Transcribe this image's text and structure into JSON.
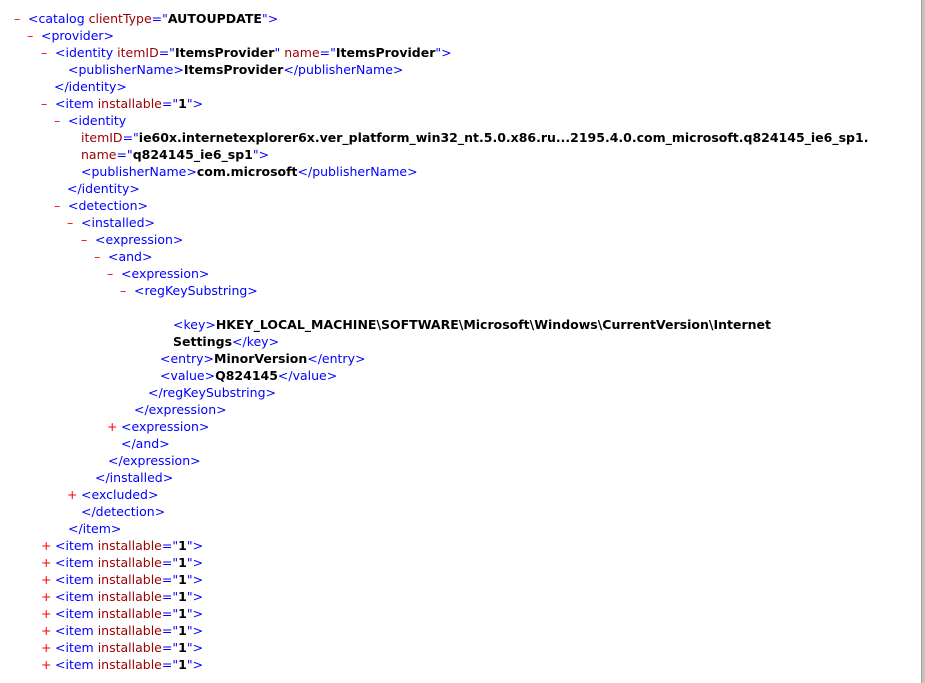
{
  "colors": {
    "toggle": "#ff0000",
    "tag": "#0000ff",
    "attr_name": "#990000",
    "value": "#000000"
  },
  "icons": {
    "collapse": "–",
    "expand": "+"
  },
  "lines": [
    {
      "depth": 0,
      "toggle": "–",
      "parts": [
        [
          "tag",
          "<catalog "
        ],
        [
          "an",
          "clientType"
        ],
        [
          "eq",
          "=\""
        ],
        [
          "av",
          "AUTOUPDATE"
        ],
        [
          "q",
          "\">"
        ]
      ]
    },
    {
      "depth": 1,
      "toggle": "–",
      "parts": [
        [
          "tag",
          "<provider>"
        ]
      ]
    },
    {
      "depth": 2,
      "toggle": "–",
      "parts": [
        [
          "tag",
          "<identity "
        ],
        [
          "an",
          "itemID"
        ],
        [
          "eq",
          "=\""
        ],
        [
          "av",
          "ItemsProvider"
        ],
        [
          "q",
          "\" "
        ],
        [
          "an",
          "name"
        ],
        [
          "eq",
          "=\""
        ],
        [
          "av",
          "ItemsProvider"
        ],
        [
          "q",
          "\">"
        ]
      ]
    },
    {
      "depth": 3,
      "toggle": "",
      "parts": [
        [
          "tag",
          "<publisherName>"
        ],
        [
          "tx",
          "ItemsProvider"
        ],
        [
          "tag",
          "</publisherName>"
        ]
      ]
    },
    {
      "depth": 3,
      "toggle": "",
      "shift": -14,
      "parts": [
        [
          "tag",
          "</identity>"
        ]
      ]
    },
    {
      "depth": 2,
      "toggle": "–",
      "parts": [
        [
          "tag",
          "<item "
        ],
        [
          "an",
          "installable"
        ],
        [
          "eq",
          "=\""
        ],
        [
          "av",
          "1"
        ],
        [
          "q",
          "\">"
        ]
      ]
    },
    {
      "depth": 3,
      "toggle": "–",
      "parts": [
        [
          "tag",
          "<identity"
        ]
      ]
    },
    {
      "depth": 4,
      "toggle": "",
      "parts": [
        [
          "an",
          "itemID"
        ],
        [
          "eq",
          "=\""
        ],
        [
          "av",
          "ie60x.internetexplorer6x.ver_platform_win32_nt.5.0.x86.ru...2195.4.0.com_microsoft.q824145_ie6_sp1."
        ]
      ]
    },
    {
      "depth": 4,
      "toggle": "",
      "parts": [
        [
          "an",
          "name"
        ],
        [
          "eq",
          "=\""
        ],
        [
          "av",
          "q824145_ie6_sp1"
        ],
        [
          "q",
          "\">"
        ]
      ]
    },
    {
      "depth": 4,
      "toggle": "",
      "parts": [
        [
          "tag",
          "<publisherName>"
        ],
        [
          "tx",
          "com.microsoft"
        ],
        [
          "tag",
          "</publisherName>"
        ]
      ]
    },
    {
      "depth": 4,
      "toggle": "",
      "shift": -14,
      "parts": [
        [
          "tag",
          "</identity>"
        ]
      ]
    },
    {
      "depth": 3,
      "toggle": "–",
      "parts": [
        [
          "tag",
          "<detection>"
        ]
      ]
    },
    {
      "depth": 4,
      "toggle": "–",
      "parts": [
        [
          "tag",
          "<installed>"
        ]
      ]
    },
    {
      "depth": 5,
      "toggle": "–",
      "parts": [
        [
          "tag",
          "<expression>"
        ]
      ]
    },
    {
      "depth": 6,
      "toggle": "–",
      "parts": [
        [
          "tag",
          "<and>"
        ]
      ]
    },
    {
      "depth": 7,
      "toggle": "–",
      "parts": [
        [
          "tag",
          "<expression>"
        ]
      ]
    },
    {
      "depth": 8,
      "toggle": "–",
      "parts": [
        [
          "tag",
          "<regKeySubstring>"
        ]
      ]
    },
    {
      "depth": 0,
      "toggle": "",
      "parts": []
    },
    {
      "depth": 10,
      "toggle": "",
      "shift": 12,
      "parts": [
        [
          "tag",
          "<key>"
        ],
        [
          "tx",
          "HKEY_LOCAL_MACHINE\\SOFTWARE\\Microsoft\\Windows\\CurrentVersion\\Internet"
        ]
      ]
    },
    {
      "depth": 10,
      "toggle": "",
      "shift": 12,
      "parts": [
        [
          "tx",
          "Settings"
        ],
        [
          "tag",
          "</key>"
        ]
      ]
    },
    {
      "depth": 10,
      "toggle": "",
      "shift": -1,
      "parts": [
        [
          "tag",
          "<entry>"
        ],
        [
          "tx",
          "MinorVersion"
        ],
        [
          "tag",
          "</entry>"
        ]
      ]
    },
    {
      "depth": 10,
      "toggle": "",
      "shift": -1,
      "parts": [
        [
          "tag",
          "<value>"
        ],
        [
          "tx",
          "Q824145"
        ],
        [
          "tag",
          "</value>"
        ]
      ]
    },
    {
      "depth": 9,
      "toggle": "",
      "parts": [
        [
          "tag",
          "</regKeySubstring>"
        ]
      ]
    },
    {
      "depth": 8,
      "toggle": "",
      "parts": [
        [
          "tag",
          "</expression>"
        ]
      ]
    },
    {
      "depth": 7,
      "toggle": "+",
      "parts": [
        [
          "tag",
          "<expression>"
        ]
      ]
    },
    {
      "depth": 7,
      "toggle": "",
      "parts": [
        [
          "tag",
          "</and>"
        ]
      ]
    },
    {
      "depth": 6,
      "toggle": "",
      "parts": [
        [
          "tag",
          "</expression>"
        ]
      ]
    },
    {
      "depth": 5,
      "toggle": "",
      "parts": [
        [
          "tag",
          "</installed>"
        ]
      ]
    },
    {
      "depth": 4,
      "toggle": "+",
      "parts": [
        [
          "tag",
          "<excluded>"
        ]
      ]
    },
    {
      "depth": 4,
      "toggle": "",
      "parts": [
        [
          "tag",
          "</detection>"
        ]
      ]
    },
    {
      "depth": 3,
      "toggle": "",
      "parts": [
        [
          "tag",
          "</item>"
        ]
      ]
    },
    {
      "depth": 2,
      "toggle": "+",
      "parts": [
        [
          "tag",
          "<item "
        ],
        [
          "an",
          "installable"
        ],
        [
          "eq",
          "=\""
        ],
        [
          "av",
          "1"
        ],
        [
          "q",
          "\">"
        ]
      ]
    },
    {
      "depth": 2,
      "toggle": "+",
      "parts": [
        [
          "tag",
          "<item "
        ],
        [
          "an",
          "installable"
        ],
        [
          "eq",
          "=\""
        ],
        [
          "av",
          "1"
        ],
        [
          "q",
          "\">"
        ]
      ]
    },
    {
      "depth": 2,
      "toggle": "+",
      "parts": [
        [
          "tag",
          "<item "
        ],
        [
          "an",
          "installable"
        ],
        [
          "eq",
          "=\""
        ],
        [
          "av",
          "1"
        ],
        [
          "q",
          "\">"
        ]
      ]
    },
    {
      "depth": 2,
      "toggle": "+",
      "parts": [
        [
          "tag",
          "<item "
        ],
        [
          "an",
          "installable"
        ],
        [
          "eq",
          "=\""
        ],
        [
          "av",
          "1"
        ],
        [
          "q",
          "\">"
        ]
      ]
    },
    {
      "depth": 2,
      "toggle": "+",
      "parts": [
        [
          "tag",
          "<item "
        ],
        [
          "an",
          "installable"
        ],
        [
          "eq",
          "=\""
        ],
        [
          "av",
          "1"
        ],
        [
          "q",
          "\">"
        ]
      ]
    },
    {
      "depth": 2,
      "toggle": "+",
      "parts": [
        [
          "tag",
          "<item "
        ],
        [
          "an",
          "installable"
        ],
        [
          "eq",
          "=\""
        ],
        [
          "av",
          "1"
        ],
        [
          "q",
          "\">"
        ]
      ]
    },
    {
      "depth": 2,
      "toggle": "+",
      "parts": [
        [
          "tag",
          "<item "
        ],
        [
          "an",
          "installable"
        ],
        [
          "eq",
          "=\""
        ],
        [
          "av",
          "1"
        ],
        [
          "q",
          "\">"
        ]
      ]
    },
    {
      "depth": 2,
      "toggle": "+",
      "parts": [
        [
          "tag",
          "<item "
        ],
        [
          "an",
          "installable"
        ],
        [
          "eq",
          "=\""
        ],
        [
          "av",
          "1"
        ],
        [
          "q",
          "\">"
        ]
      ]
    }
  ]
}
